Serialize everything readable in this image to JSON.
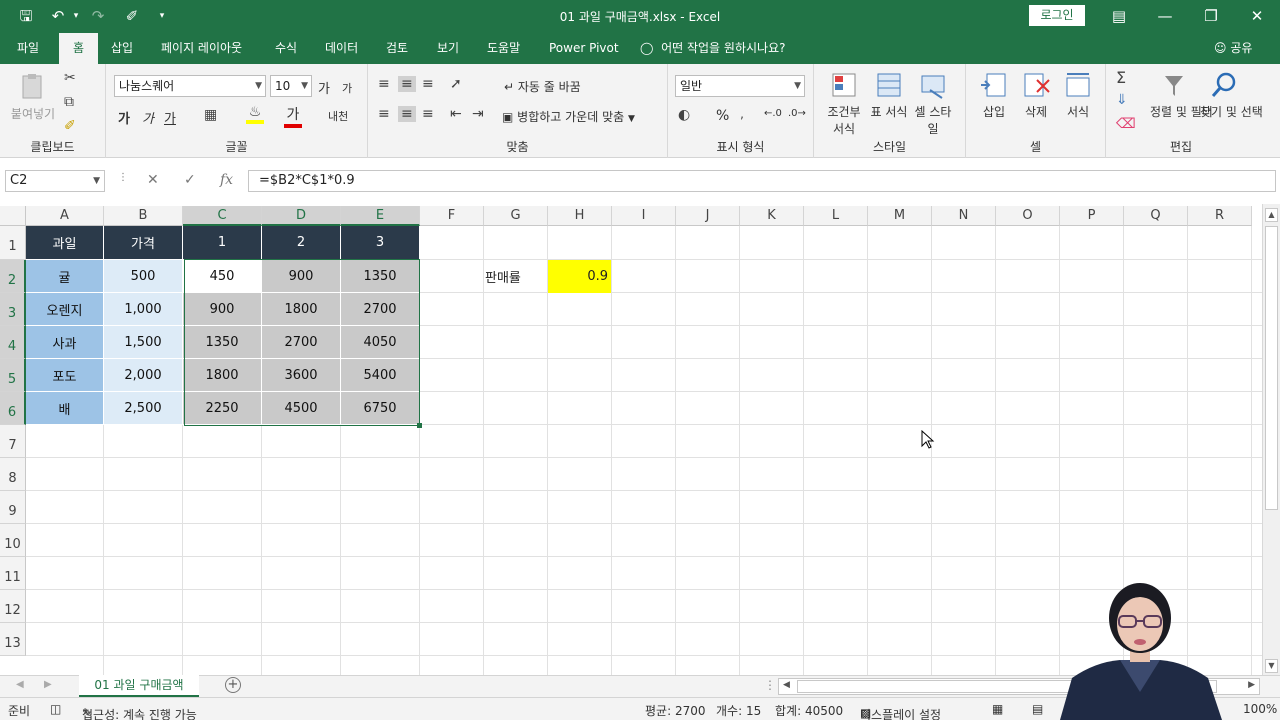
{
  "window": {
    "title": "01 과일 구매금액.xlsx  -  Excel",
    "login": "로그인",
    "minimize": "—",
    "restore": "❐",
    "close": "✕"
  },
  "tabs": [
    "파일",
    "홈",
    "삽입",
    "페이지 레이아웃",
    "수식",
    "데이터",
    "검토",
    "보기",
    "도움말",
    "Power Pivot"
  ],
  "active_tab": "홈",
  "tell_me": "어떤 작업을 원하시나요?",
  "share": "공유",
  "ribbon": {
    "clipboard": {
      "label": "클립보드",
      "paste": "붙여넣기"
    },
    "font": {
      "label": "글꼴",
      "name": "나눔스퀘어",
      "size": "10",
      "bold": "가",
      "italic": "가",
      "underline": "가",
      "grow": "가",
      "shrink": "가",
      "phonetic": "내천"
    },
    "alignment": {
      "label": "맞춤",
      "wrap": "자동 줄 바꿈",
      "merge": "병합하고 가운데 맞춤"
    },
    "number": {
      "label": "표시 형식",
      "format": "일반",
      "percent": "%"
    },
    "styles": {
      "label": "스타일",
      "conditional": "조건부 서식",
      "table": "표 서식",
      "cell": "셀 스타일"
    },
    "cells": {
      "label": "셀",
      "insert": "삽입",
      "delete": "삭제",
      "format": "서식"
    },
    "editing": {
      "label": "편집",
      "sort": "정렬 및 필터",
      "find": "찾기 및 선택"
    }
  },
  "formula_bar": {
    "name_box": "C2",
    "formula": "=$B2*C$1*0.9"
  },
  "columns": [
    "A",
    "B",
    "C",
    "D",
    "E",
    "F",
    "G",
    "H",
    "I",
    "J",
    "K",
    "L",
    "M",
    "N",
    "O",
    "P",
    "Q",
    "R"
  ],
  "rows": [
    "1",
    "2",
    "3",
    "4",
    "5",
    "6",
    "7",
    "8",
    "9",
    "10",
    "11",
    "12",
    "13"
  ],
  "table": {
    "header": [
      "과일",
      "가격",
      "1",
      "2",
      "3"
    ],
    "body": [
      [
        "귤",
        "500",
        "450",
        "900",
        "1350"
      ],
      [
        "오렌지",
        "1,000",
        "900",
        "1800",
        "2700"
      ],
      [
        "사과",
        "1,500",
        "1350",
        "2700",
        "4050"
      ],
      [
        "포도",
        "2,000",
        "1800",
        "3600",
        "5400"
      ],
      [
        "배",
        "2,500",
        "2250",
        "4500",
        "6750"
      ]
    ]
  },
  "sales_rate": {
    "label": "판매률",
    "value": "0.9"
  },
  "sheet_tab": "01 과일 구매금액",
  "status": {
    "ready": "준비",
    "accessibility": "접근성: 계속 진행 가능",
    "average": "평균: 2700",
    "count": "개수: 15",
    "sum": "합계: 40500",
    "display": "디스플레이 설정",
    "zoom": "100%"
  },
  "colors": {
    "excel_green": "#217346",
    "header_dark": "#2b3a4a",
    "fruit_blue": "#9dc3e6",
    "price_blue": "#ddebf7",
    "value_gray": "#c9c9c9",
    "highlight": "#ffff00"
  }
}
